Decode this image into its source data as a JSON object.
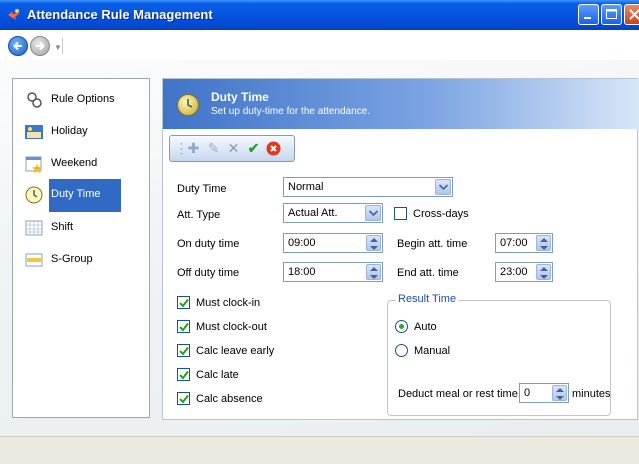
{
  "window": {
    "title": "Attendance Rule Management"
  },
  "sidebar": {
    "items": [
      {
        "label": "Rule Options",
        "icon": "rule-options-icon",
        "selected": false
      },
      {
        "label": "Holiday",
        "icon": "holiday-icon",
        "selected": false
      },
      {
        "label": "Weekend",
        "icon": "weekend-icon",
        "selected": false
      },
      {
        "label": "Duty Time",
        "icon": "clock-icon",
        "selected": true
      },
      {
        "label": "Shift",
        "icon": "shift-icon",
        "selected": false
      },
      {
        "label": "S-Group",
        "icon": "s-group-icon",
        "selected": false
      }
    ]
  },
  "header": {
    "title": "Duty Time",
    "subtitle": "Set up duty-time for the attendance."
  },
  "toolbar": {
    "tools": [
      "add-icon",
      "edit-icon",
      "delete-icon",
      "save-icon",
      "cancel-icon"
    ]
  },
  "form": {
    "duty_time": {
      "label": "Duty Time",
      "value": "Normal"
    },
    "att_type": {
      "label": "Att. Type",
      "value": "Actual Att."
    },
    "cross_days": {
      "label": "Cross-days",
      "checked": false
    },
    "on_duty": {
      "label": "On duty time",
      "value": "09:00"
    },
    "begin_att": {
      "label": "Begin att. time",
      "value": "07:00"
    },
    "off_duty": {
      "label": "Off duty time",
      "value": "18:00"
    },
    "end_att": {
      "label": "End att. time",
      "value": "23:00"
    },
    "checks": [
      {
        "label": "Must clock-in",
        "checked": true
      },
      {
        "label": "Must clock-out",
        "checked": true
      },
      {
        "label": "Calc leave early",
        "checked": true
      },
      {
        "label": "Calc late",
        "checked": true
      },
      {
        "label": "Calc absence",
        "checked": true
      }
    ]
  },
  "result_time": {
    "title": "Result Time",
    "auto_label": "Auto",
    "manual_label": "Manual",
    "selected": "auto",
    "deduct_label": "Deduct meal or rest time",
    "deduct_value": "0",
    "unit": "minutes"
  },
  "colors": {
    "accent": "#316ac5",
    "titlebar": "#0553e0"
  }
}
